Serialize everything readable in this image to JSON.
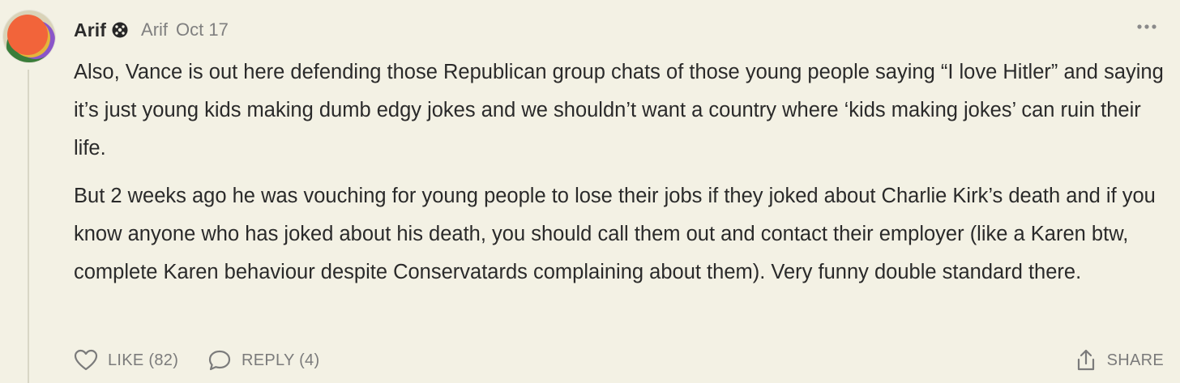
{
  "comment": {
    "author": "Arif",
    "handle": "Arif",
    "date": "Oct 17",
    "paragraphs": [
      "Also, Vance is out here defending those Republican group chats of those young people saying “I love Hitler” and saying it’s just young kids making dumb edgy jokes and we shouldn’t want a country where ‘kids making jokes’ can ruin their life.",
      "But 2 weeks ago he was vouching for young people to lose their jobs if they joked about Charlie Kirk’s death and if you know anyone who has joked about his death, you should call them out and contact their employer (like a Karen btw, complete Karen behaviour despite Conservatards complaining about them). Very funny double standard there."
    ],
    "actions": {
      "like_label": "LIKE (82)",
      "reply_label": "REPLY (4)",
      "share_label": "SHARE"
    }
  },
  "icons": {
    "avatar": "avatar-orange-circle",
    "badge": "verified-badge-icon",
    "more": "more-icon",
    "like": "heart-icon",
    "reply": "speech-bubble-icon",
    "share": "share-icon"
  },
  "colors": {
    "background": "#f3f1e4",
    "text": "#2a2a2a",
    "muted": "#7b7b7b",
    "avatar_primary": "#f2643a"
  }
}
